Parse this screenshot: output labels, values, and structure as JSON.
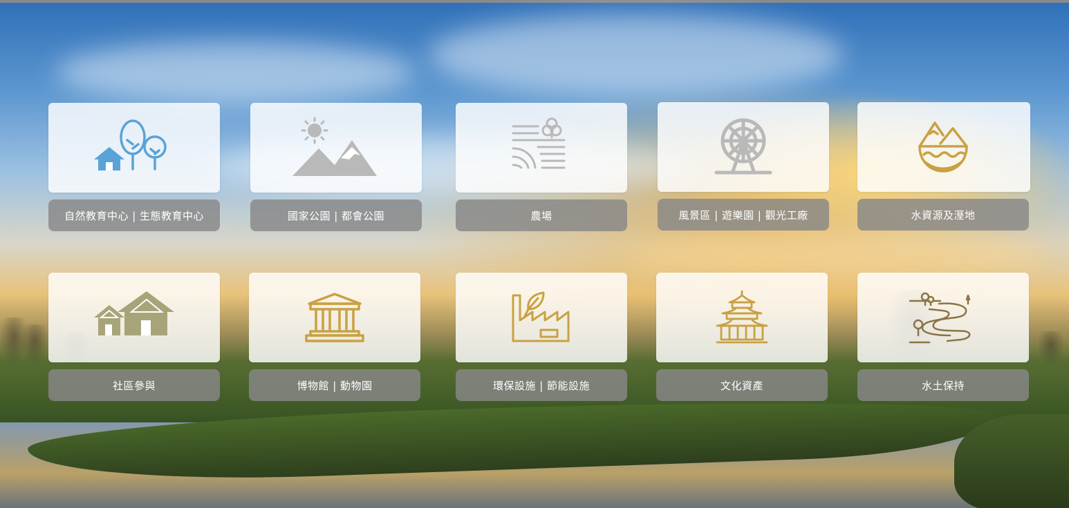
{
  "colors": {
    "blue_icon": "#5aa3d6",
    "grey_icon": "#b9b9b9",
    "gold_icon": "#c9a143",
    "label_bg": "#878787",
    "card_bg": "#ffffff"
  },
  "categories": [
    {
      "label": "自然教育中心 | 生態教育中心",
      "icon": "nature-education-icon"
    },
    {
      "label": "國家公園 | 都會公園",
      "icon": "mountain-park-icon"
    },
    {
      "label": "農場",
      "icon": "farm-icon"
    },
    {
      "label": "風景區 | 遊樂園 | 觀光工廠",
      "icon": "ferris-wheel-icon"
    },
    {
      "label": "水資源及溼地",
      "icon": "water-resource-icon"
    },
    {
      "label": "社區參與",
      "icon": "community-houses-icon"
    },
    {
      "label": "博物館 | 動物園",
      "icon": "museum-icon"
    },
    {
      "label": "環保設施 | 節能設施",
      "icon": "eco-factory-icon"
    },
    {
      "label": "文化資產",
      "icon": "temple-icon"
    },
    {
      "label": "水土保持",
      "icon": "soil-conservation-icon"
    }
  ]
}
